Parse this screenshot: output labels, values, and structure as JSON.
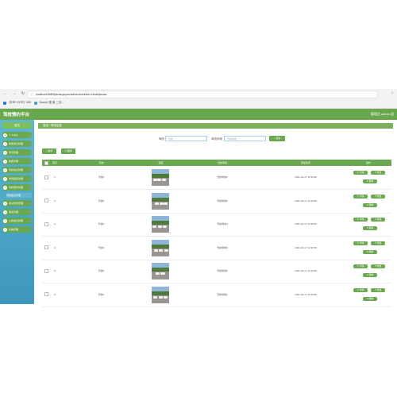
{
  "browser": {
    "url": "localhost:8080/jiaxiaoyuyue/admin/dist/index.html#/jiaxiao",
    "bookmarks": [
      "【ERP-CRS】VIEI",
      "Search 搜 索 二次..."
    ]
  },
  "app": {
    "title": "驾校预约平台",
    "user": "管理员 admin",
    "user_extra": "退"
  },
  "sidebar": {
    "home": "首页",
    "items": [
      {
        "label": "个人中心",
        "icon": "user-icon"
      },
      {
        "label": "教练信息管理",
        "icon": "coach-icon"
      },
      {
        "label": "学员管理",
        "icon": "student-icon"
      },
      {
        "label": "教练管理",
        "icon": "teacher-icon"
      },
      {
        "label": "驾校信息管理",
        "icon": "school-icon"
      },
      {
        "label": "学员报名管理",
        "icon": "signup-icon"
      },
      {
        "label": "驾校预约管理",
        "icon": "booking-icon"
      }
    ],
    "active_sub": "驾校信息管理",
    "items2": [
      {
        "label": "考试安排管理",
        "icon": "exam-icon"
      },
      {
        "label": "留言管理",
        "icon": "message-icon"
      },
      {
        "label": "公告信息管理",
        "icon": "notice-icon"
      },
      {
        "label": "系统管理",
        "icon": "gear-icon"
      }
    ]
  },
  "breadcrumb": {
    "home": "首页",
    "sep": "/",
    "current": "驾校信息"
  },
  "search": {
    "label1": "驾校",
    "placeholder1": "驾校",
    "label2": "驾校场地",
    "placeholder2": "驾校场地",
    "button": "查询"
  },
  "actions": {
    "add": "新增",
    "delete": "删除"
  },
  "table": {
    "headers": [
      "",
      "索引",
      "驾校",
      "封面",
      "驾校场地",
      "添加时间",
      "操作"
    ],
    "row_buttons": {
      "detail": "详情",
      "edit": "修改",
      "delete": "删除"
    },
    "rows": [
      {
        "index": "1",
        "name": "驾校6",
        "field": "驾校场地6",
        "time": "2021-04-17 11:36:59"
      },
      {
        "index": "2",
        "name": "驾校5",
        "field": "驾校场地5",
        "time": "2021-04-17 11:36:59"
      },
      {
        "index": "3",
        "name": "驾校4",
        "field": "驾校场地4",
        "time": "2021-04-17 11:36:59"
      },
      {
        "index": "4",
        "name": "驾校3",
        "field": "驾校场地3",
        "time": "2021-04-17 11:36:59"
      },
      {
        "index": "5",
        "name": "驾校2",
        "field": "驾校场地2",
        "time": "2021-04-17 11:36:59"
      },
      {
        "index": "6",
        "name": "驾校1",
        "field": "驾校场地1",
        "time": "2021-04-17 11:36:59"
      }
    ]
  },
  "colors": {
    "primary": "#6aa84f",
    "sidebar": "#4aa6c6"
  }
}
